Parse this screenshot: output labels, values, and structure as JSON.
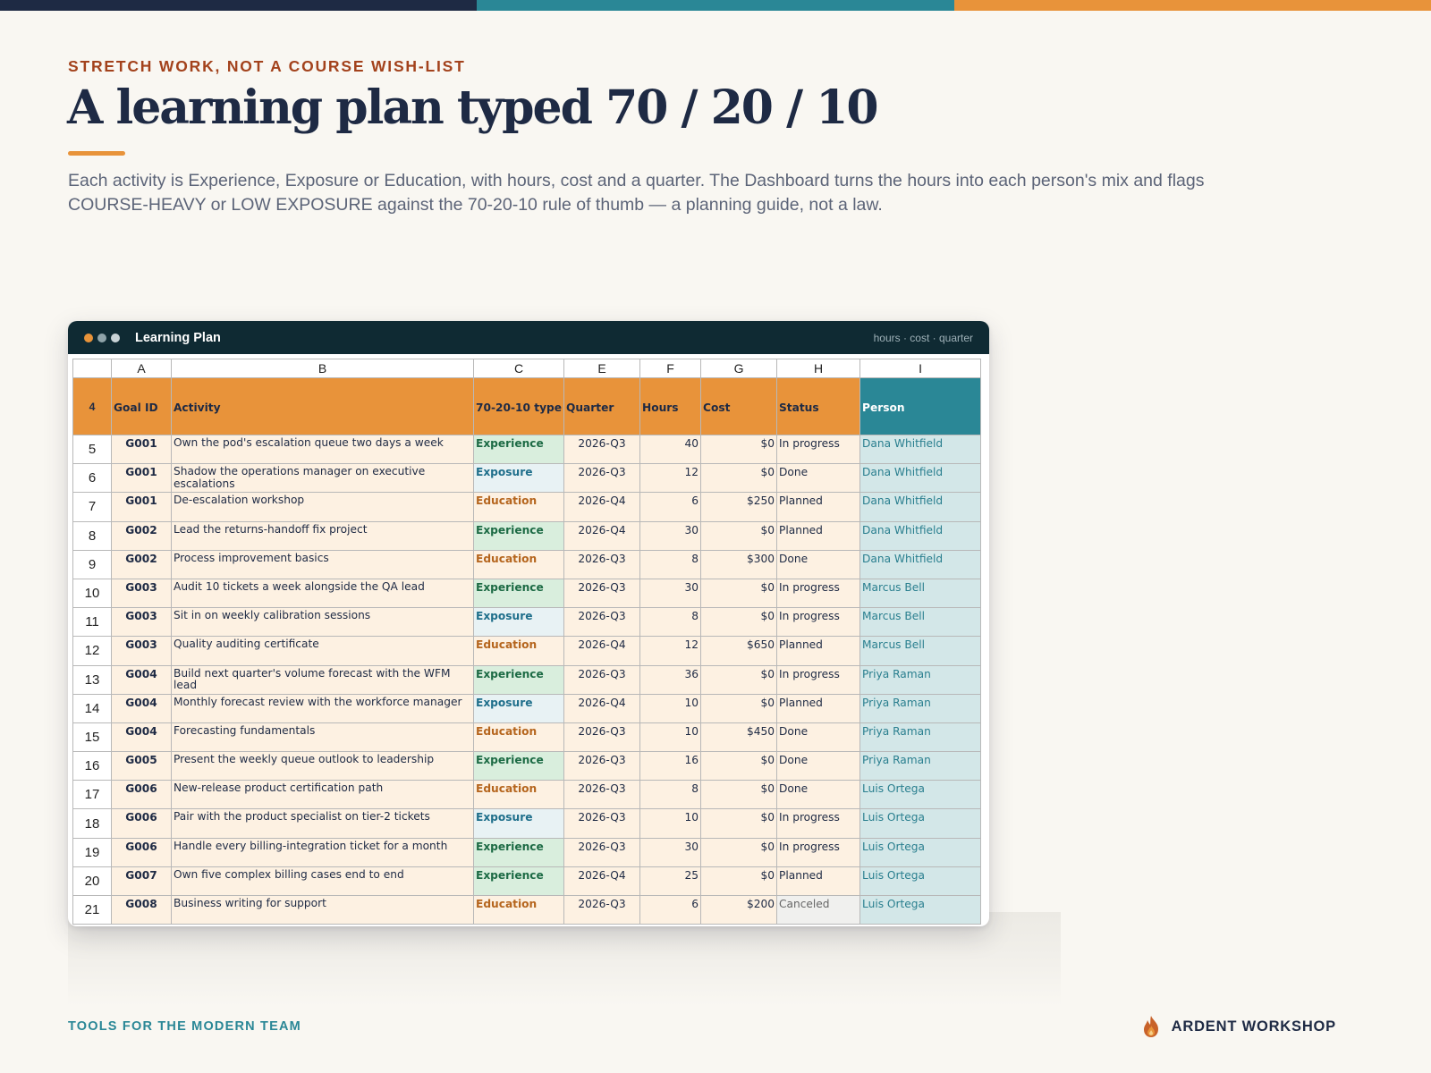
{
  "colors": {
    "navy": "#1e2a44",
    "teal": "#2a8796",
    "orange": "#e8933a",
    "rust": "#a3421c",
    "cream": "#f9f7f2"
  },
  "header": {
    "eyebrow": "STRETCH WORK, NOT A COURSE WISH-LIST",
    "title": "A learning plan typed 70 / 20 / 10",
    "lede": "Each activity is Experience, Exposure or Education, with hours, cost and a quarter. The Dashboard turns the hours into each person's mix and flags COURSE-HEAVY or LOW EXPOSURE against the 70-20-10 rule of thumb — a planning guide, not a law."
  },
  "window": {
    "title": "Learning Plan",
    "meta": "hours · cost · quarter"
  },
  "sheet": {
    "col_letters": [
      "A",
      "B",
      "C",
      "E",
      "F",
      "G",
      "H",
      "I"
    ],
    "header_row_number": "4",
    "headers": [
      "Goal ID",
      "Activity",
      "70-20-10 type",
      "Quarter",
      "Hours",
      "Cost",
      "Status",
      "Person"
    ],
    "rows": [
      {
        "n": "5",
        "goal": "G001",
        "activity": "Own the pod's escalation queue two days a week",
        "type": "Experience",
        "quarter": "2026-Q3",
        "hours": "40",
        "cost": "$0",
        "status": "In progress",
        "person": "Dana Whitfield"
      },
      {
        "n": "6",
        "goal": "G001",
        "activity": "Shadow the operations manager on executive escalations",
        "type": "Exposure",
        "quarter": "2026-Q3",
        "hours": "12",
        "cost": "$0",
        "status": "Done",
        "person": "Dana Whitfield"
      },
      {
        "n": "7",
        "goal": "G001",
        "activity": "De-escalation workshop",
        "type": "Education",
        "quarter": "2026-Q4",
        "hours": "6",
        "cost": "$250",
        "status": "Planned",
        "person": "Dana Whitfield"
      },
      {
        "n": "8",
        "goal": "G002",
        "activity": "Lead the returns-handoff fix project",
        "type": "Experience",
        "quarter": "2026-Q4",
        "hours": "30",
        "cost": "$0",
        "status": "Planned",
        "person": "Dana Whitfield"
      },
      {
        "n": "9",
        "goal": "G002",
        "activity": "Process improvement basics",
        "type": "Education",
        "quarter": "2026-Q3",
        "hours": "8",
        "cost": "$300",
        "status": "Done",
        "person": "Dana Whitfield"
      },
      {
        "n": "10",
        "goal": "G003",
        "activity": "Audit 10 tickets a week alongside the QA lead",
        "type": "Experience",
        "quarter": "2026-Q3",
        "hours": "30",
        "cost": "$0",
        "status": "In progress",
        "person": "Marcus Bell"
      },
      {
        "n": "11",
        "goal": "G003",
        "activity": "Sit in on weekly calibration sessions",
        "type": "Exposure",
        "quarter": "2026-Q3",
        "hours": "8",
        "cost": "$0",
        "status": "In progress",
        "person": "Marcus Bell"
      },
      {
        "n": "12",
        "goal": "G003",
        "activity": "Quality auditing certificate",
        "type": "Education",
        "quarter": "2026-Q4",
        "hours": "12",
        "cost": "$650",
        "status": "Planned",
        "person": "Marcus Bell"
      },
      {
        "n": "13",
        "goal": "G004",
        "activity": "Build next quarter's volume forecast with the WFM lead",
        "type": "Experience",
        "quarter": "2026-Q3",
        "hours": "36",
        "cost": "$0",
        "status": "In progress",
        "person": "Priya Raman"
      },
      {
        "n": "14",
        "goal": "G004",
        "activity": "Monthly forecast review with the workforce manager",
        "type": "Exposure",
        "quarter": "2026-Q4",
        "hours": "10",
        "cost": "$0",
        "status": "Planned",
        "person": "Priya Raman"
      },
      {
        "n": "15",
        "goal": "G004",
        "activity": "Forecasting fundamentals",
        "type": "Education",
        "quarter": "2026-Q3",
        "hours": "10",
        "cost": "$450",
        "status": "Done",
        "person": "Priya Raman"
      },
      {
        "n": "16",
        "goal": "G005",
        "activity": "Present the weekly queue outlook to leadership",
        "type": "Experience",
        "quarter": "2026-Q3",
        "hours": "16",
        "cost": "$0",
        "status": "Done",
        "person": "Priya Raman"
      },
      {
        "n": "17",
        "goal": "G006",
        "activity": "New-release product certification path",
        "type": "Education",
        "quarter": "2026-Q3",
        "hours": "8",
        "cost": "$0",
        "status": "Done",
        "person": "Luis Ortega"
      },
      {
        "n": "18",
        "goal": "G006",
        "activity": "Pair with the product specialist on tier-2 tickets",
        "type": "Exposure",
        "quarter": "2026-Q3",
        "hours": "10",
        "cost": "$0",
        "status": "In progress",
        "person": "Luis Ortega"
      },
      {
        "n": "19",
        "goal": "G006",
        "activity": "Handle every billing-integration ticket for a month",
        "type": "Experience",
        "quarter": "2026-Q3",
        "hours": "30",
        "cost": "$0",
        "status": "In progress",
        "person": "Luis Ortega"
      },
      {
        "n": "20",
        "goal": "G007",
        "activity": "Own five complex billing cases end to end",
        "type": "Experience",
        "quarter": "2026-Q4",
        "hours": "25",
        "cost": "$0",
        "status": "Planned",
        "person": "Luis Ortega"
      },
      {
        "n": "21",
        "goal": "G008",
        "activity": "Business writing for support",
        "type": "Education",
        "quarter": "2026-Q3",
        "hours": "6",
        "cost": "$200",
        "status": "Canceled",
        "person": "Luis Ortega"
      }
    ]
  },
  "footer": {
    "tagline": "TOOLS FOR THE MODERN TEAM",
    "brand": "ARDENT WORKSHOP",
    "brand_icon": "flame-icon"
  }
}
